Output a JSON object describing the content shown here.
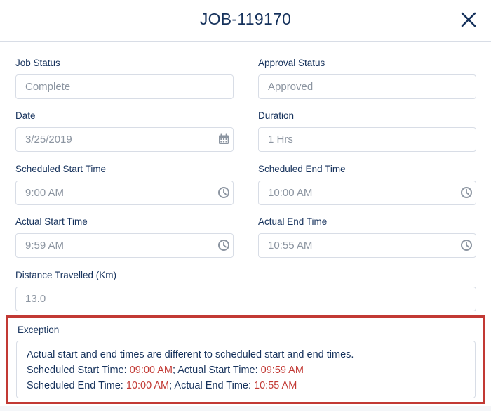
{
  "header": {
    "title": "JOB-119170",
    "close_icon": "close-icon"
  },
  "fields": {
    "job_status": {
      "label": "Job Status",
      "value": "Complete"
    },
    "approval_status": {
      "label": "Approval Status",
      "value": "Approved"
    },
    "date": {
      "label": "Date",
      "value": "3/25/2019",
      "icon": "calendar-icon"
    },
    "duration": {
      "label": "Duration",
      "value": "1 Hrs"
    },
    "scheduled_start": {
      "label": "Scheduled Start Time",
      "value": "9:00 AM",
      "icon": "clock-icon"
    },
    "scheduled_end": {
      "label": "Scheduled End Time",
      "value": "10:00 AM",
      "icon": "clock-icon"
    },
    "actual_start": {
      "label": "Actual Start Time",
      "value": "9:59 AM",
      "icon": "clock-icon"
    },
    "actual_end": {
      "label": "Actual End Time",
      "value": "10:55 AM",
      "icon": "clock-icon"
    },
    "distance": {
      "label": "Distance Travelled (Km)",
      "value": "13.0"
    }
  },
  "exception": {
    "label": "Exception",
    "line1": "Actual start and end times are different to scheduled start and end times.",
    "line2": {
      "prefix": "Scheduled Start Time: ",
      "scheduled_value": "09:00 AM",
      "middle": "; Actual Start Time: ",
      "actual_value": "09:59 AM"
    },
    "line3": {
      "prefix": "Scheduled End Time: ",
      "scheduled_value": "10:00 AM",
      "middle": "; Actual End Time: ",
      "actual_value": "10:55 AM"
    },
    "highlight_color": "#c23934"
  }
}
